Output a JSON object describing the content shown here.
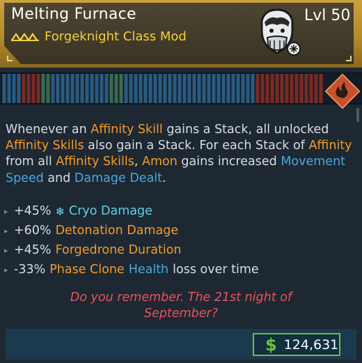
{
  "item": {
    "name": "Melting Furnace",
    "class_mod": "Forgeknight Class Mod",
    "level": "Lvl 50",
    "rarity_icon": "triple-chevron-icon",
    "portrait_icon": "bearded-warrior-portrait-icon",
    "element_icon": "fire-element-icon"
  },
  "description": {
    "p1": "Whenever an ",
    "k1": "Affinity Skill",
    "p2": " gains a Stack, all unlocked ",
    "k2": "Affinity Skills",
    "p3": " also gain a Stack. For each Stack of ",
    "k3": "Affinity",
    "p4": " from all ",
    "k4": "Affinity Skills",
    "p5": ", ",
    "k5": "Amon",
    "p6": " gains increased ",
    "b1": "Movement Speed",
    "p7": " and ",
    "b2": "Damage Dealt",
    "p8": "."
  },
  "stats": [
    {
      "value": "+45%",
      "label": "Cryo Damage",
      "icon": "snowflake-icon"
    },
    {
      "value": "+60%",
      "label": "Detonation Damage"
    },
    {
      "value": "+45%",
      "label": "Forgedrone Duration"
    },
    {
      "value": "-33%",
      "label_orange": "Phase Clone",
      "label_blue": "Health",
      "label_rest": "loss over time"
    }
  ],
  "flavor": {
    "line1": "Do you remember. The 21st night of",
    "line2": "September?"
  },
  "price": {
    "symbol": "$",
    "amount": "124,631"
  },
  "colors": {
    "accent_gold": "#f3cf3f",
    "orange_keyword": "#f39b2a",
    "blue_keyword": "#4aa8de",
    "flavor_red": "#e8545c",
    "price_green": "#6ac43a"
  }
}
